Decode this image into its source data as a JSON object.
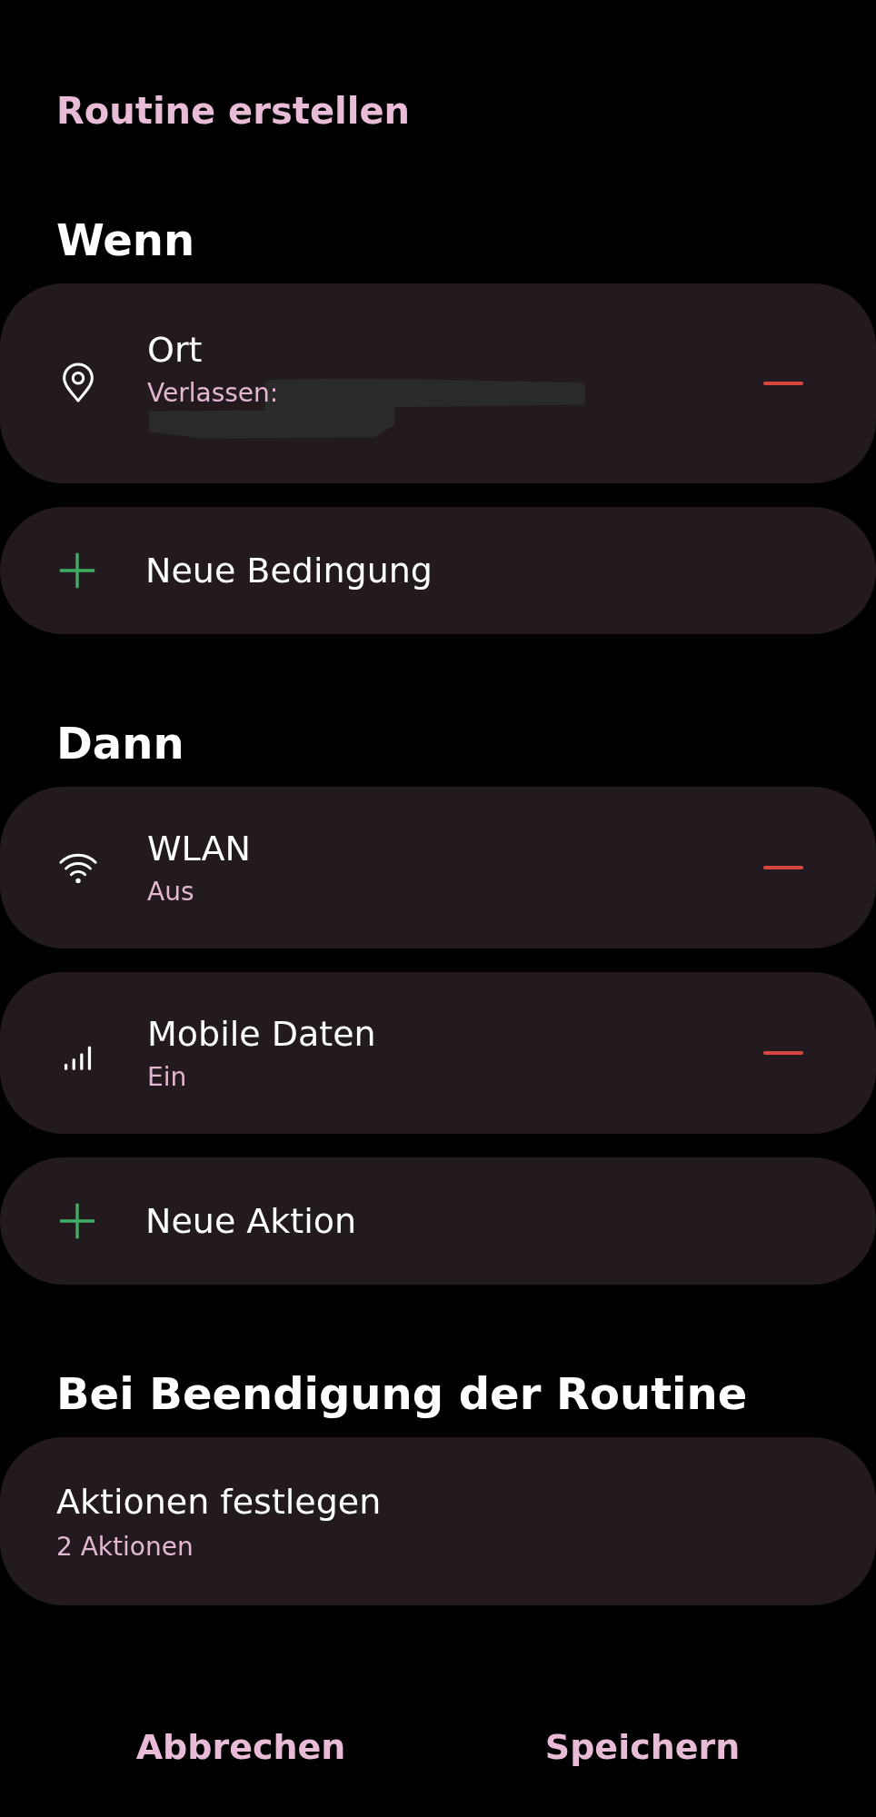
{
  "title": "Routine erstellen",
  "sections": [
    {
      "heading": "Wenn",
      "items": [
        {
          "kind": "location",
          "title": "Ort",
          "subtitle": "Verlassen:",
          "redacted": true,
          "removable": true
        },
        {
          "kind": "add",
          "title": "Neue Bedingung"
        }
      ]
    },
    {
      "heading": "Dann",
      "items": [
        {
          "kind": "wifi",
          "title": "WLAN",
          "subtitle": "Aus",
          "removable": true
        },
        {
          "kind": "signal",
          "title": "Mobile Daten",
          "subtitle": "Ein",
          "removable": true
        },
        {
          "kind": "add",
          "title": "Neue Aktion"
        }
      ]
    },
    {
      "heading": "Bei Beendigung der Routine",
      "items": [
        {
          "kind": "summary",
          "title": "Aktionen festlegen",
          "subtitle": "2 Aktionen"
        }
      ]
    }
  ],
  "buttons": [
    "Abbrechen",
    "Speichern"
  ]
}
